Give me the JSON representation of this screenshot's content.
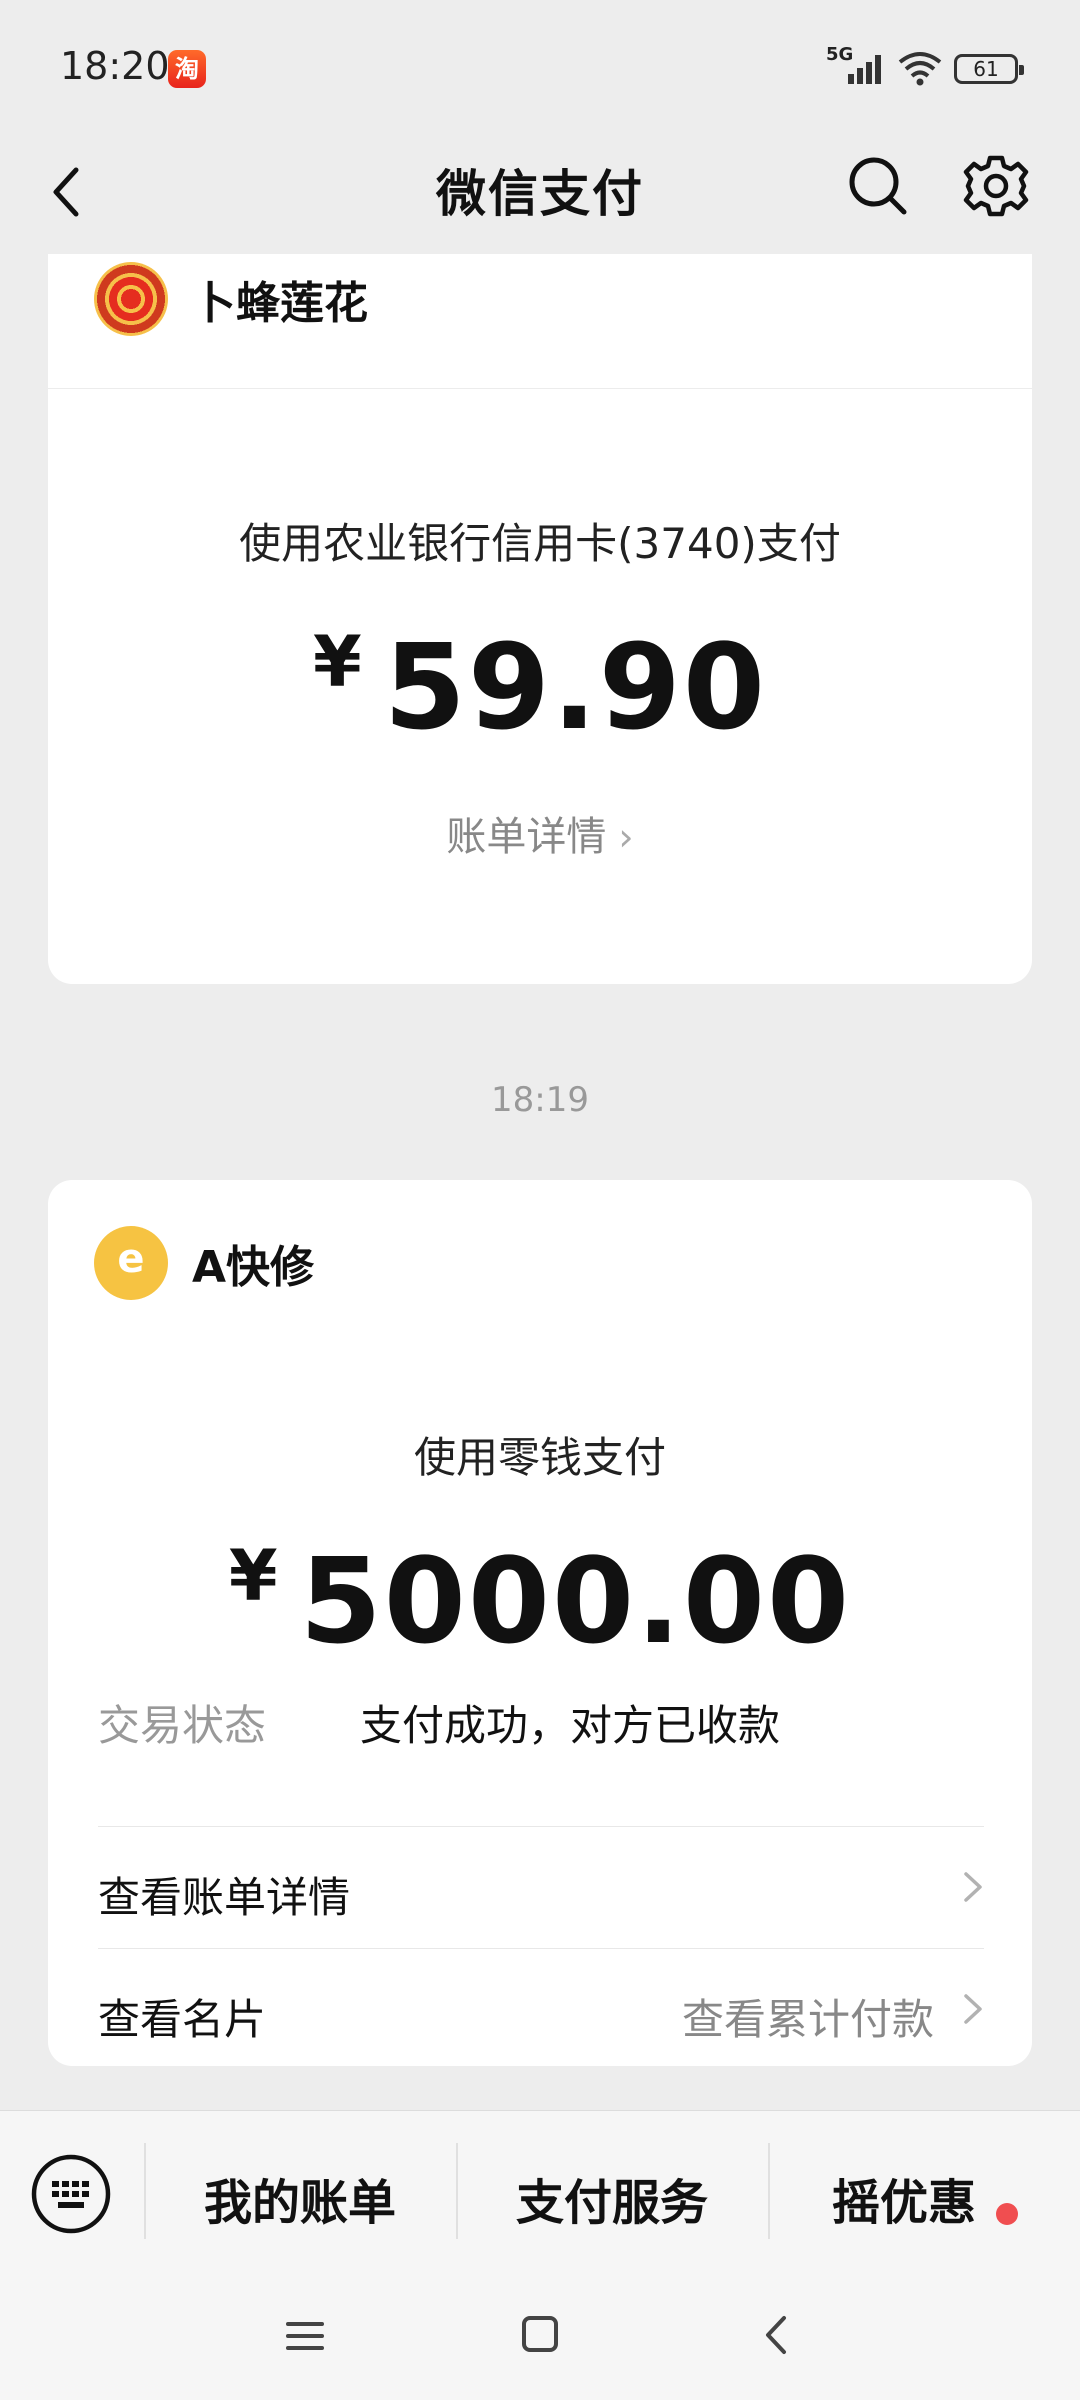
{
  "status_bar": {
    "time": "18:20",
    "app_badge": "淘",
    "network": "5G",
    "battery": "61"
  },
  "nav": {
    "title": "微信支付"
  },
  "transactions": [
    {
      "merchant": "卜蜂莲花",
      "pay_method": "使用农业银行信用卡(3740)支付",
      "currency": "¥",
      "amount": "59.90",
      "bill_link": "账单详情"
    },
    {
      "merchant": "A快修",
      "merchant_logo_char": "e",
      "pay_method": "使用零钱支付",
      "currency": "¥",
      "amount": "5000.00",
      "status_label": "交易状态",
      "status_value": "支付成功，对方已收款",
      "rows": [
        {
          "label": "查看账单详情",
          "right": ""
        },
        {
          "label": "查看名片",
          "right": "查看累计付款"
        }
      ]
    }
  ],
  "time_separator": "18:19",
  "tab_bar": {
    "tabs": [
      "我的账单",
      "支付服务",
      "摇优惠"
    ]
  },
  "colors": {
    "background": "#ededed",
    "card": "#ffffff",
    "red_dot": "#f04e50"
  }
}
